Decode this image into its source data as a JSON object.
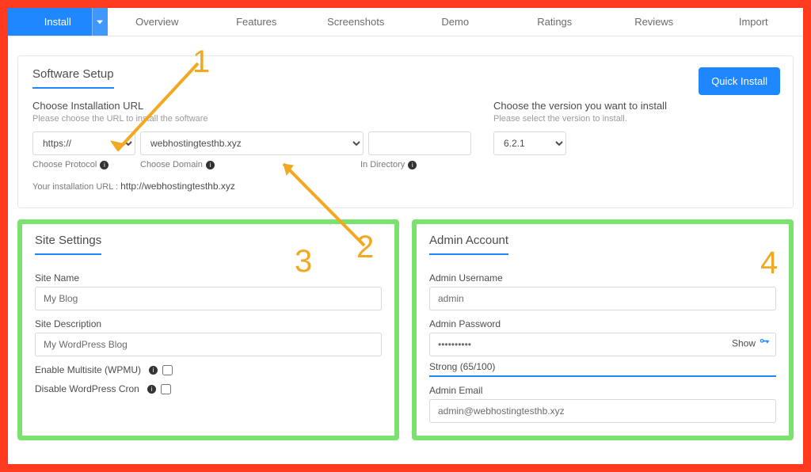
{
  "tabs": {
    "items": [
      "Install",
      "Overview",
      "Features",
      "Screenshots",
      "Demo",
      "Ratings",
      "Reviews",
      "Import"
    ],
    "active": "Install"
  },
  "setup": {
    "title": "Software Setup",
    "quick": "Quick Install",
    "url_heading": "Choose Installation URL",
    "url_sub": "Please choose the URL to install the software",
    "protocol": "https://",
    "domain": "webhostingtesthb.xyz",
    "directory": "",
    "hint_protocol": "Choose Protocol",
    "hint_domain": "Choose Domain",
    "hint_directory": "In Directory",
    "install_url_label": "Your installation URL :",
    "install_url": "http://webhostingtesthb.xyz",
    "version_heading": "Choose the version you want to install",
    "version_sub": "Please select the version to install.",
    "version": "6.2.1"
  },
  "site": {
    "title": "Site Settings",
    "name_label": "Site Name",
    "name": "My Blog",
    "desc_label": "Site Description",
    "desc": "My WordPress Blog",
    "multisite_label": "Enable Multisite (WPMU)",
    "cron_label": "Disable WordPress Cron",
    "multisite": false,
    "cron": false
  },
  "admin": {
    "title": "Admin Account",
    "user_label": "Admin Username",
    "user": "admin",
    "pass_label": "Admin Password",
    "pass": "••••••••••",
    "show": "Show",
    "strength": "Strong (65/100)",
    "email_label": "Admin Email",
    "email": "admin@webhostingtesthb.xyz"
  },
  "notes": {
    "n1": "1",
    "n2": "2",
    "n3": "3",
    "n4": "4"
  }
}
